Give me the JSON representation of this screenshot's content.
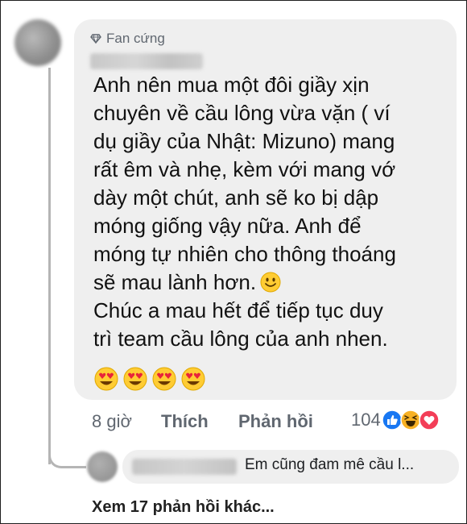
{
  "comment": {
    "badge_label": "Fan cứng",
    "badge_icon": "diamond-icon",
    "text_lines": [
      "Anh nên mua một đôi giầy xịn",
      "chuyên về cầu lông vừa vặn ( ví",
      "dụ giầy của Nhật: Mizuno) mang",
      "rất êm và nhẹ, kèm với mang vớ",
      "dày một chút, anh sẽ ko bị dập",
      "móng giống vậy nữa. Anh để",
      "móng tự nhiên cho thông thoáng",
      "sẽ mau lành hơn.",
      "Chúc a mau hết để tiếp tục duy",
      "trì team cầu lông của anh nhen."
    ],
    "emoji": [
      "slightly-smiling-face",
      "heart-eyes",
      "heart-eyes",
      "heart-eyes",
      "heart-eyes"
    ]
  },
  "actions": {
    "time": "8 giờ",
    "like_label": "Thích",
    "reply_label": "Phản hồi"
  },
  "reactions": {
    "count": "104",
    "types": [
      "like",
      "haha",
      "love"
    ]
  },
  "reply": {
    "text": "Em cũng đam mê cầu l..."
  },
  "more_replies_label": "Xem 17 phản hồi khác...",
  "colors": {
    "bubble": "#efefef",
    "meta_text": "#606770",
    "like_blue": "#1877f2",
    "love_red": "#f33e58",
    "haha_yellow": "#f7b125"
  }
}
